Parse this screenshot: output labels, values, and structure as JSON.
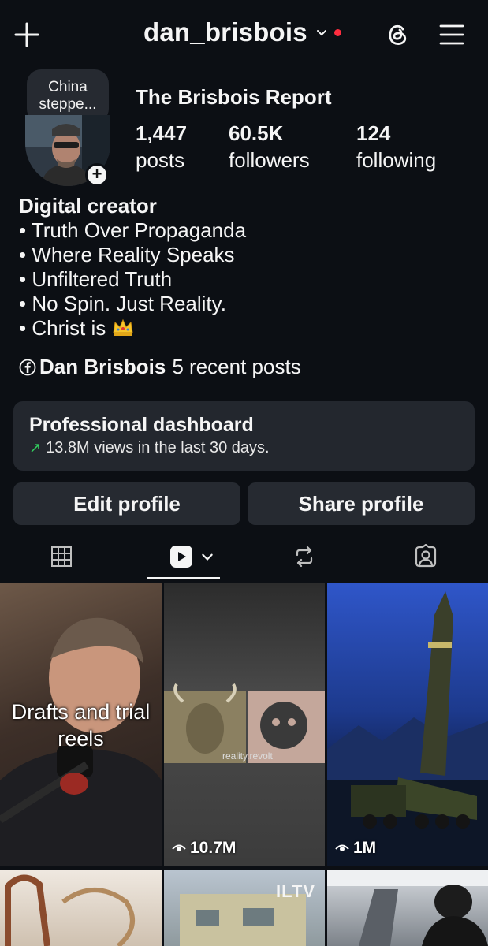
{
  "header": {
    "username": "dan_brisbois",
    "icons": [
      "plus-icon",
      "chevron-down-icon",
      "notification-dot",
      "threads-icon",
      "menu-icon"
    ]
  },
  "profile": {
    "note": "China steppe...",
    "display_name": "The Brisbois Report",
    "stats": [
      {
        "value": "1,447",
        "label": "posts"
      },
      {
        "value": "60.5K",
        "label": "followers"
      },
      {
        "value": "124",
        "label": "following"
      }
    ]
  },
  "bio": {
    "category": "Digital creator",
    "lines": [
      "• Truth Over Propaganda",
      "• Where Reality Speaks",
      "• Unfiltered Truth",
      "• No Spin. Just Reality.",
      "• Christ is"
    ],
    "emoji": "crown-emoji"
  },
  "facebook": {
    "name": "Dan Brisbois",
    "recent": "5 recent posts"
  },
  "dashboard": {
    "title": "Professional dashboard",
    "subtitle": "13.8M views in the last 30 days.",
    "trend_color": "#32d15f"
  },
  "actions": {
    "edit": "Edit profile",
    "share": "Share profile"
  },
  "tabs": [
    "grid-icon",
    "reels-icon",
    "reposts-icon",
    "tagged-icon"
  ],
  "grid": {
    "tile1_text": "Drafts and trial reels",
    "tile2_watermark": "reality.revolt",
    "tile2_views": "10.7M",
    "tile3_views": "1M",
    "tile5_logo": "ILTV"
  },
  "colors": {
    "background": "#0c0f14",
    "surface": "#23272e",
    "accent_dot": "#ff2d3f"
  }
}
